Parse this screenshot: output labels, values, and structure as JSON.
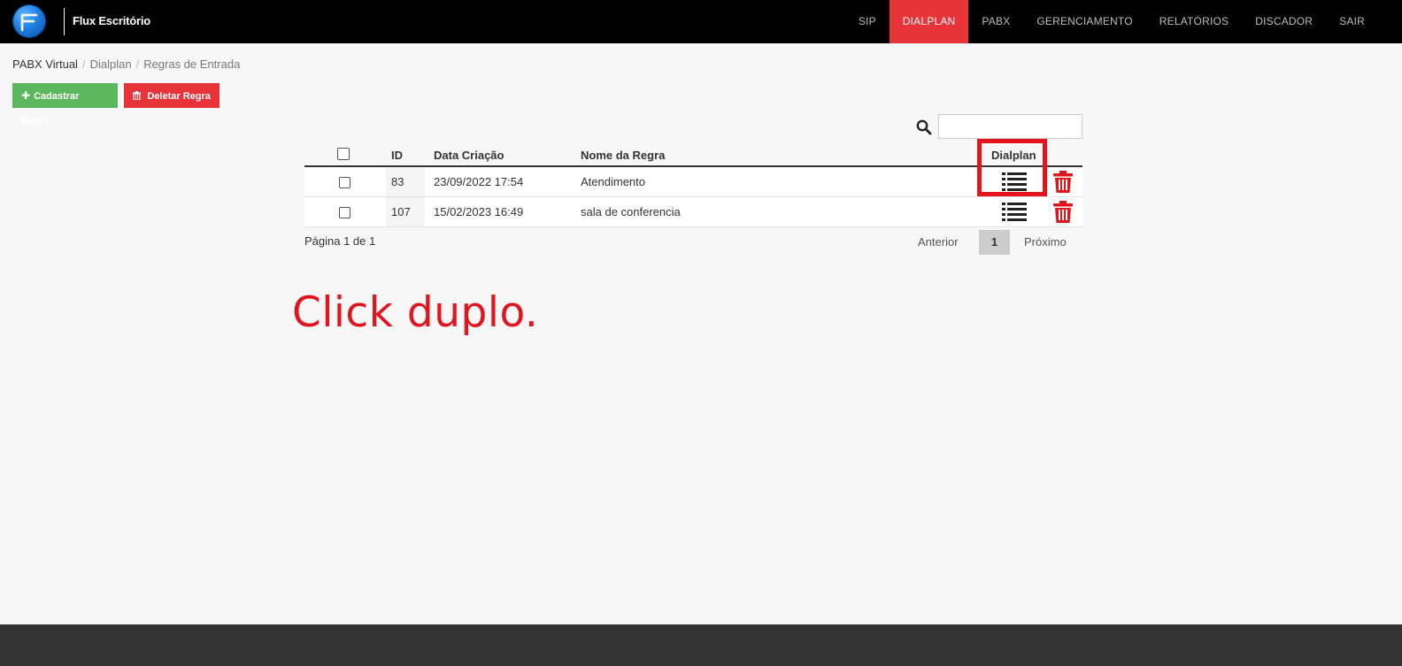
{
  "app": {
    "brand": "Flux Escritório"
  },
  "nav": {
    "items": [
      {
        "label": "SIP"
      },
      {
        "label": "DIALPLAN",
        "active": true
      },
      {
        "label": "PABX"
      },
      {
        "label": "GERENCIAMENTO"
      },
      {
        "label": "RELATÓRIOS"
      },
      {
        "label": "DISCADOR"
      },
      {
        "label": "SAIR"
      }
    ]
  },
  "breadcrumb": [
    "PABX Virtual",
    "Dialplan",
    "Regras de Entrada"
  ],
  "actions": {
    "add_label": "Cadastrar Regra",
    "add_icon": "plus-icon",
    "delete_label": "Deletar Regra",
    "delete_icon": "trash-icon"
  },
  "search": {
    "value": ""
  },
  "table": {
    "headers": {
      "id": "ID",
      "date": "Data Criação",
      "name": "Nome da Regra",
      "dialplan": "Dialplan"
    },
    "rows": [
      {
        "id": "83",
        "date": "23/09/2022 17:54",
        "name": "Atendimento"
      },
      {
        "id": "107",
        "date": "15/02/2023 16:49",
        "name": "sala de conferencia"
      }
    ]
  },
  "pagination": {
    "info": "Página 1 de 1",
    "prev": "Anterior",
    "current": "1",
    "next": "Próximo"
  },
  "annotation": {
    "text": "Click duplo."
  },
  "colors": {
    "accent_red": "#e8333a",
    "success_green": "#5cb85c",
    "annotation_red": "#e3141c"
  }
}
